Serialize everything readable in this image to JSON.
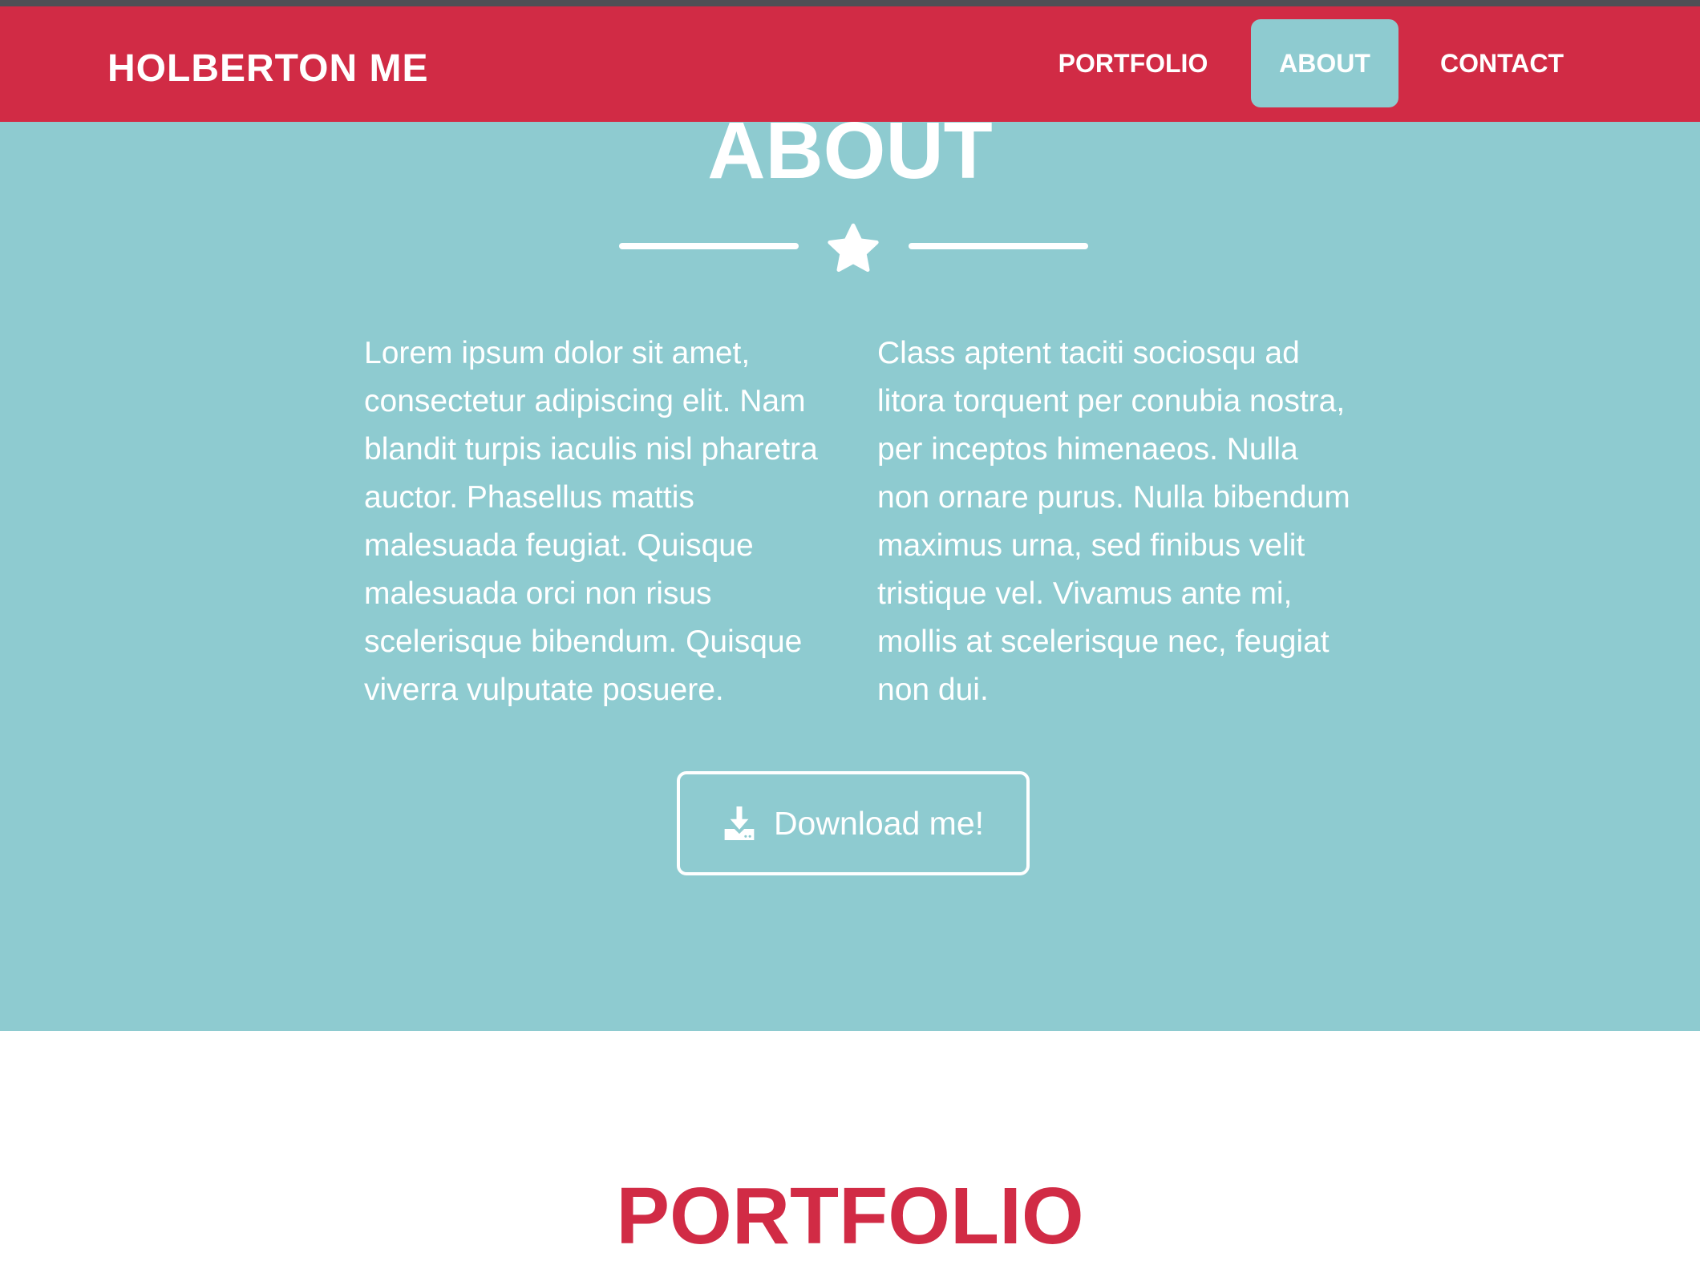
{
  "colors": {
    "brand_red": "#d12b45",
    "teal": "#8ecbd0",
    "white": "#ffffff",
    "window_top": "#4f4f55"
  },
  "navbar": {
    "brand": "HOLBERTON ME",
    "items": [
      {
        "label": "PORTFOLIO",
        "active": false
      },
      {
        "label": "ABOUT",
        "active": true
      },
      {
        "label": "CONTACT",
        "active": false
      }
    ]
  },
  "about": {
    "title": "ABOUT",
    "divider_icon": "star-icon",
    "column_left": "Lorem ipsum dolor sit amet, consectetur adipiscing elit. Nam blandit turpis iaculis nisl pharetra auctor. Phasellus mattis malesuada feugiat. Quisque malesuada orci non risus scelerisque bibendum. Quisque viverra vulputate posuere.",
    "column_right": "Class aptent taciti sociosqu ad litora torquent per conubia nostra, per inceptos himenaeos. Nulla non ornare purus. Nulla bibendum maximus urna, sed finibus velit tristique vel. Vivamus ante mi, mollis at scelerisque nec, feugiat non dui.",
    "download_button": {
      "label": "Download me!",
      "icon": "download-icon"
    }
  },
  "portfolio": {
    "title": "PORTFOLIO"
  }
}
